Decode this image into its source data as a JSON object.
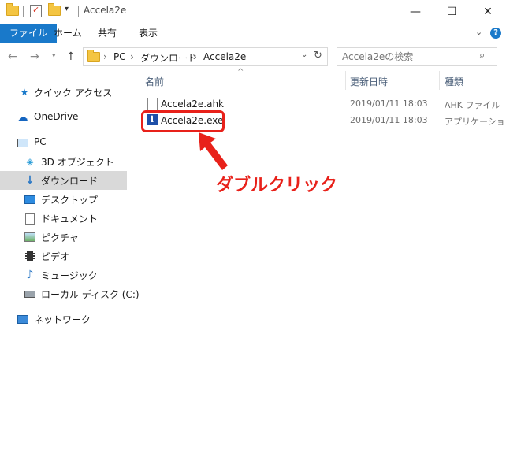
{
  "window": {
    "title": "Accela2e",
    "controls": {
      "minimize": "—",
      "maximize": "☐",
      "close": "✕"
    }
  },
  "ribbon": {
    "tabs": [
      {
        "label": "ファイル",
        "active": true
      },
      {
        "label": "ホーム"
      },
      {
        "label": "共有"
      },
      {
        "label": "表示"
      }
    ]
  },
  "address": {
    "crumbs": [
      "PC",
      "ダウンロード",
      "Accela2e"
    ],
    "search_placeholder": "Accela2eの検索"
  },
  "nav": {
    "items": [
      {
        "label": "クイック アクセス",
        "icon": "star-icon"
      },
      {
        "label": "OneDrive",
        "icon": "cloud-icon"
      },
      {
        "label": "PC",
        "icon": "computer-icon"
      },
      {
        "label": "3D オブジェクト",
        "icon": "cube-icon"
      },
      {
        "label": "ダウンロード",
        "icon": "download-icon",
        "selected": true
      },
      {
        "label": "デスクトップ",
        "icon": "desktop-icon"
      },
      {
        "label": "ドキュメント",
        "icon": "document-icon"
      },
      {
        "label": "ピクチャ",
        "icon": "picture-icon"
      },
      {
        "label": "ビデオ",
        "icon": "video-icon"
      },
      {
        "label": "ミュージック",
        "icon": "music-icon"
      },
      {
        "label": "ローカル ディスク (C:)",
        "icon": "disk-icon"
      },
      {
        "label": "ネットワーク",
        "icon": "network-icon"
      }
    ]
  },
  "files": {
    "columns": {
      "name": "名前",
      "date": "更新日時",
      "type": "種類"
    },
    "rows": [
      {
        "name": "Accela2e.ahk",
        "date": "2019/01/11 18:03",
        "type": "AHK ファイル",
        "icon": "text-file-icon"
      },
      {
        "name": "Accela2e.exe",
        "date": "2019/01/11 18:03",
        "type": "アプリケーション",
        "icon": "exe-icon"
      }
    ]
  },
  "annotation": {
    "text": "ダブルクリック",
    "color": "#e8211a"
  },
  "colors": {
    "accent": "#1979ca",
    "selected_bg": "#d9d9d9",
    "highlight": "#e8211a"
  }
}
